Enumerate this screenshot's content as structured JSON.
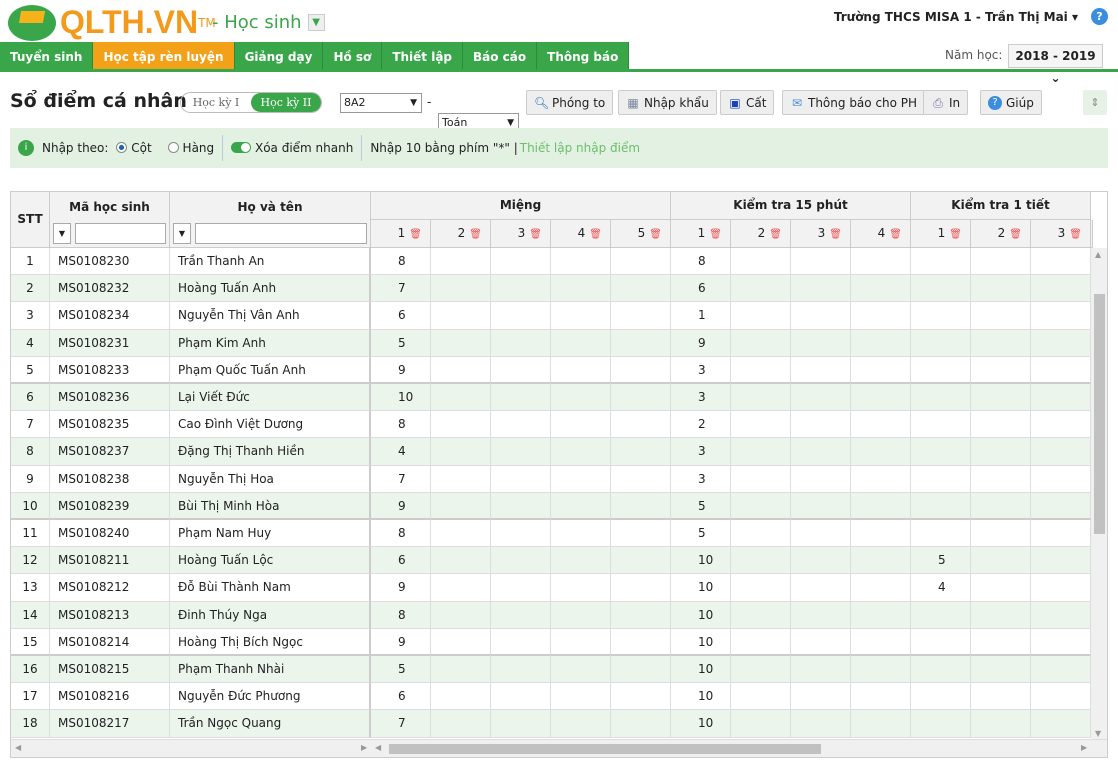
{
  "header": {
    "logo_text": "QLTH.VN",
    "logo_tm": "TM",
    "role": "- Học sinh",
    "user": "Trường THCS MISA 1 - Trần Thị Mai ▾",
    "help": "?"
  },
  "nav": [
    "Tuyển sinh",
    "Học tập rèn luyện",
    "Giảng dạy",
    "Hồ sơ",
    "Thiết lập",
    "Báo cáo",
    "Thông báo"
  ],
  "nav_active": 1,
  "year": {
    "label": "Năm học:",
    "value": "2018 - 2019 ⌄"
  },
  "page": {
    "title": "Sổ điểm cá nhân",
    "sem1": "Học kỳ I",
    "sem2": "Học kỳ II",
    "class": "8A2",
    "subject": "Toán"
  },
  "toolbar": {
    "zoom": "Phóng to",
    "import": "Nhập khẩu",
    "save": "Cất",
    "notify": "Thông báo cho PH",
    "print": "In",
    "help": "Giúp"
  },
  "bar": {
    "label": "Nhập theo:",
    "col": "Cột",
    "row": "Hàng",
    "quick": "Xóa điểm nhanh",
    "hint": "Nhập 10 bằng phím \"*\" |",
    "link": "Thiết lập nhập điểm"
  },
  "table": {
    "headers": {
      "stt": "STT",
      "code": "Mã học sinh",
      "name": "Họ và tên",
      "g1": "Miệng",
      "g2": "Kiểm tra 15 phút",
      "g3": "Kiểm tra 1 tiết"
    },
    "sub_g1": [
      "1",
      "2",
      "3",
      "4",
      "5"
    ],
    "sub_g2": [
      "1",
      "2",
      "3",
      "4"
    ],
    "sub_g3": [
      "1",
      "2",
      "3"
    ],
    "rows": [
      {
        "stt": "1",
        "code": "MS0108230",
        "name": "Trần Thanh An",
        "m": "8",
        "k15": "8",
        "k1": ""
      },
      {
        "stt": "2",
        "code": "MS0108232",
        "name": "Hoàng Tuấn Anh",
        "m": "7",
        "k15": "6",
        "k1": ""
      },
      {
        "stt": "3",
        "code": "MS0108234",
        "name": "Nguyễn Thị Vân Anh",
        "m": "6",
        "k15": "1",
        "k1": ""
      },
      {
        "stt": "4",
        "code": "MS0108231",
        "name": "Phạm Kim Anh",
        "m": "5",
        "k15": "9",
        "k1": ""
      },
      {
        "stt": "5",
        "code": "MS0108233",
        "name": "Phạm Quốc Tuấn Anh",
        "m": "9",
        "k15": "3",
        "k1": ""
      },
      {
        "stt": "6",
        "code": "MS0108236",
        "name": "Lại Viết Đức",
        "m": "10",
        "k15": "3",
        "k1": ""
      },
      {
        "stt": "7",
        "code": "MS0108235",
        "name": "Cao Đình Việt Dương",
        "m": "8",
        "k15": "2",
        "k1": ""
      },
      {
        "stt": "8",
        "code": "MS0108237",
        "name": "Đặng Thị Thanh Hiền",
        "m": "4",
        "k15": "3",
        "k1": ""
      },
      {
        "stt": "9",
        "code": "MS0108238",
        "name": "Nguyễn Thị Hoa",
        "m": "7",
        "k15": "3",
        "k1": ""
      },
      {
        "stt": "10",
        "code": "MS0108239",
        "name": "Bùi Thị Minh Hòa",
        "m": "9",
        "k15": "5",
        "k1": ""
      },
      {
        "stt": "11",
        "code": "MS0108240",
        "name": "Phạm Nam Huy",
        "m": "8",
        "k15": "5",
        "k1": ""
      },
      {
        "stt": "12",
        "code": "MS0108211",
        "name": "Hoàng Tuấn Lộc",
        "m": "6",
        "k15": "10",
        "k1": "5"
      },
      {
        "stt": "13",
        "code": "MS0108212",
        "name": "Đỗ Bùi Thành Nam",
        "m": "9",
        "k15": "10",
        "k1": "4"
      },
      {
        "stt": "14",
        "code": "MS0108213",
        "name": "Đinh Thúy Nga",
        "m": "8",
        "k15": "10",
        "k1": ""
      },
      {
        "stt": "15",
        "code": "MS0108214",
        "name": "Hoàng Thị Bích Ngọc",
        "m": "9",
        "k15": "10",
        "k1": ""
      },
      {
        "stt": "16",
        "code": "MS0108215",
        "name": "Phạm Thanh Nhài",
        "m": "5",
        "k15": "10",
        "k1": ""
      },
      {
        "stt": "17",
        "code": "MS0108216",
        "name": "Nguyễn Đức Phương",
        "m": "6",
        "k15": "10",
        "k1": ""
      },
      {
        "stt": "18",
        "code": "MS0108217",
        "name": "Trần Ngọc Quang",
        "m": "7",
        "k15": "10",
        "k1": ""
      }
    ]
  },
  "colors": {
    "brand_green": "#3aa64a",
    "brand_orange": "#f4a11a",
    "row_alt": "#ebf5eb"
  }
}
